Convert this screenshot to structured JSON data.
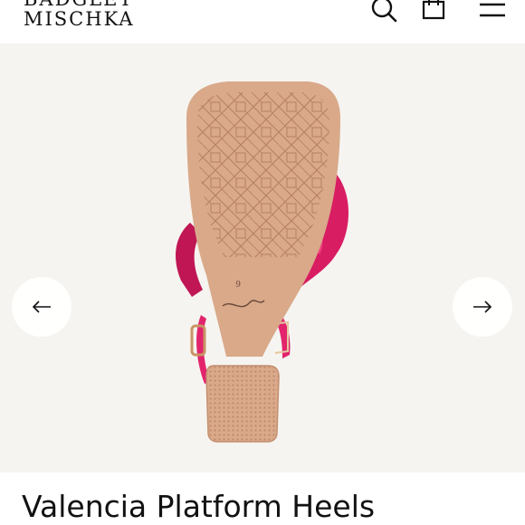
{
  "header": {
    "brand_line1": "BADGLEY",
    "brand_line2": "MISCHKA",
    "icons": [
      "search-icon",
      "shopping-bag-icon",
      "menu-icon"
    ]
  },
  "gallery": {
    "image": "sandal-sole-view",
    "sole_size_mark": "6",
    "prev_icon": "arrow-left-icon",
    "next_icon": "arrow-right-icon",
    "colors": {
      "background": "#f6f4f0",
      "sole": "#d9a98a",
      "strap": "#d81d63"
    }
  },
  "product": {
    "title": "Valencia Platform Heels"
  }
}
